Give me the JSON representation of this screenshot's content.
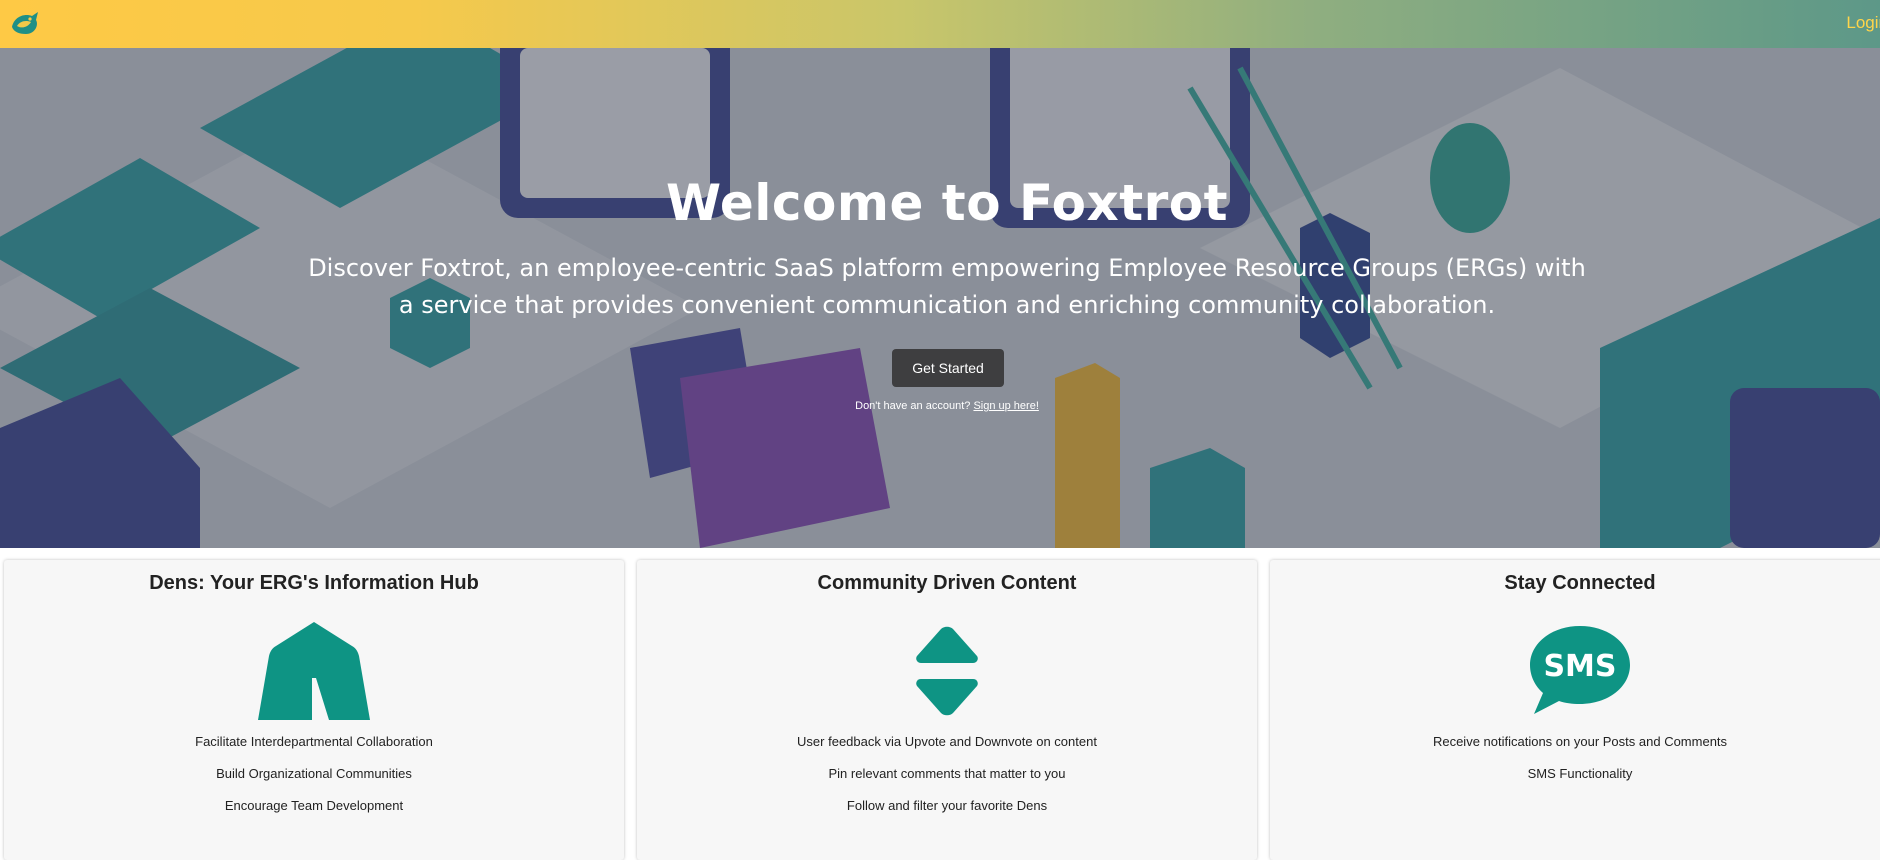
{
  "navbar": {
    "login_label": "Login",
    "logo_icon": "foxtrot-logo-icon",
    "gradient": [
      "#fec945",
      "#5d9888"
    ]
  },
  "hero": {
    "title": "Welcome to Foxtrot",
    "subtitle": "Discover Foxtrot, an employee-centric SaaS platform empowering Employee Resource Groups (ERGs) with a service that provides convenient communication and enriching community collaboration.",
    "cta_label": "Get Started",
    "signup_prompt": "Don't have an account?",
    "signup_link": "Sign up here!"
  },
  "features": [
    {
      "title": "Dens: Your ERG's Information Hub",
      "icon": "tent-icon",
      "items": [
        "Facilitate Interdepartmental Collaboration",
        "Build Organizational Communities",
        "Encourage Team Development"
      ]
    },
    {
      "title": "Community Driven Content",
      "icon": "upvote-downvote-icon",
      "items": [
        "User feedback via Upvote and Downvote on content",
        "Pin relevant comments that matter to you",
        "Follow and filter your favorite Dens"
      ]
    },
    {
      "title": "Stay Connected",
      "icon": "sms-icon",
      "icon_text": "SMS",
      "items": [
        "Receive notifications on your Posts and Comments",
        "SMS Functionality"
      ]
    }
  ],
  "colors": {
    "accent": "#0e9484",
    "button": "#3e3e40",
    "login": "#ffd54a"
  }
}
